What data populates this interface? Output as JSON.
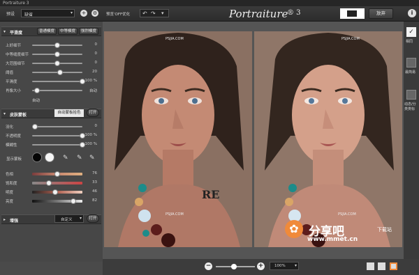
{
  "window": {
    "title": "Portraiture 3"
  },
  "topbar": {
    "preset_label": "预设",
    "preset_value": "缺省",
    "preview_label": "预览'OFF优化",
    "logo": "Portraiture",
    "logo_version": "® 3",
    "cancel_label": "放弃"
  },
  "smoothing": {
    "title": "平滑度",
    "tabs": [
      "普通模度",
      "中等模度",
      "强烈模度"
    ],
    "sliders": [
      {
        "label": "上好细节",
        "value": "0",
        "pos": 0.5
      },
      {
        "label": "中等缝度细节",
        "value": "0",
        "pos": 0.5
      },
      {
        "label": "大范围细节",
        "value": "0",
        "pos": 0.5
      },
      {
        "label": "阈值",
        "value": "20",
        "pos": 0.55
      },
      {
        "label": "平滑度",
        "value": "100",
        "unit": "%",
        "pos": 1.0
      },
      {
        "label": "肖像大小",
        "value": "自动",
        "pos": 0.1
      }
    ],
    "auto_label": "自动"
  },
  "skin": {
    "title": "皮肤蒙板",
    "auto_tip": "自动蒙板拾色",
    "toggle": "打开",
    "sliders": [
      {
        "label": "羽化",
        "value": "0",
        "pos": 0.05
      },
      {
        "label": "不透明度",
        "value": "100",
        "unit": "%",
        "pos": 1.0
      },
      {
        "label": "模糊性",
        "value": "100",
        "unit": "%",
        "pos": 1.0
      }
    ],
    "show_mask": "显示蒙板",
    "color_sliders": [
      {
        "label": "色相",
        "value": "76",
        "pos": 0.5
      },
      {
        "label": "饱和度",
        "value": "33",
        "pos": 0.33
      },
      {
        "label": "明度",
        "value": "46",
        "pos": 0.46
      },
      {
        "label": "亮度",
        "value": "82",
        "pos": 0.82
      }
    ]
  },
  "enhance": {
    "title": "增强",
    "preset": "自定义",
    "toggle": "打开"
  },
  "right_panel": {
    "items": [
      "相同",
      "最简易",
      "动态/分类类标"
    ]
  },
  "watermarks": [
    "PSJIA.COM",
    "PSJIA.COM",
    "PSJIA.COM",
    "PSJIA.COM",
    "RE"
  ],
  "bottom": {
    "zoom": "100%",
    "site": "分享吧",
    "site_sub": "下载站",
    "url": "www.mmet.cn"
  },
  "colors": {
    "bg": "#4a4a4a",
    "panel": "#474747",
    "accent": "#f08a3a",
    "skin": "#c98870"
  }
}
